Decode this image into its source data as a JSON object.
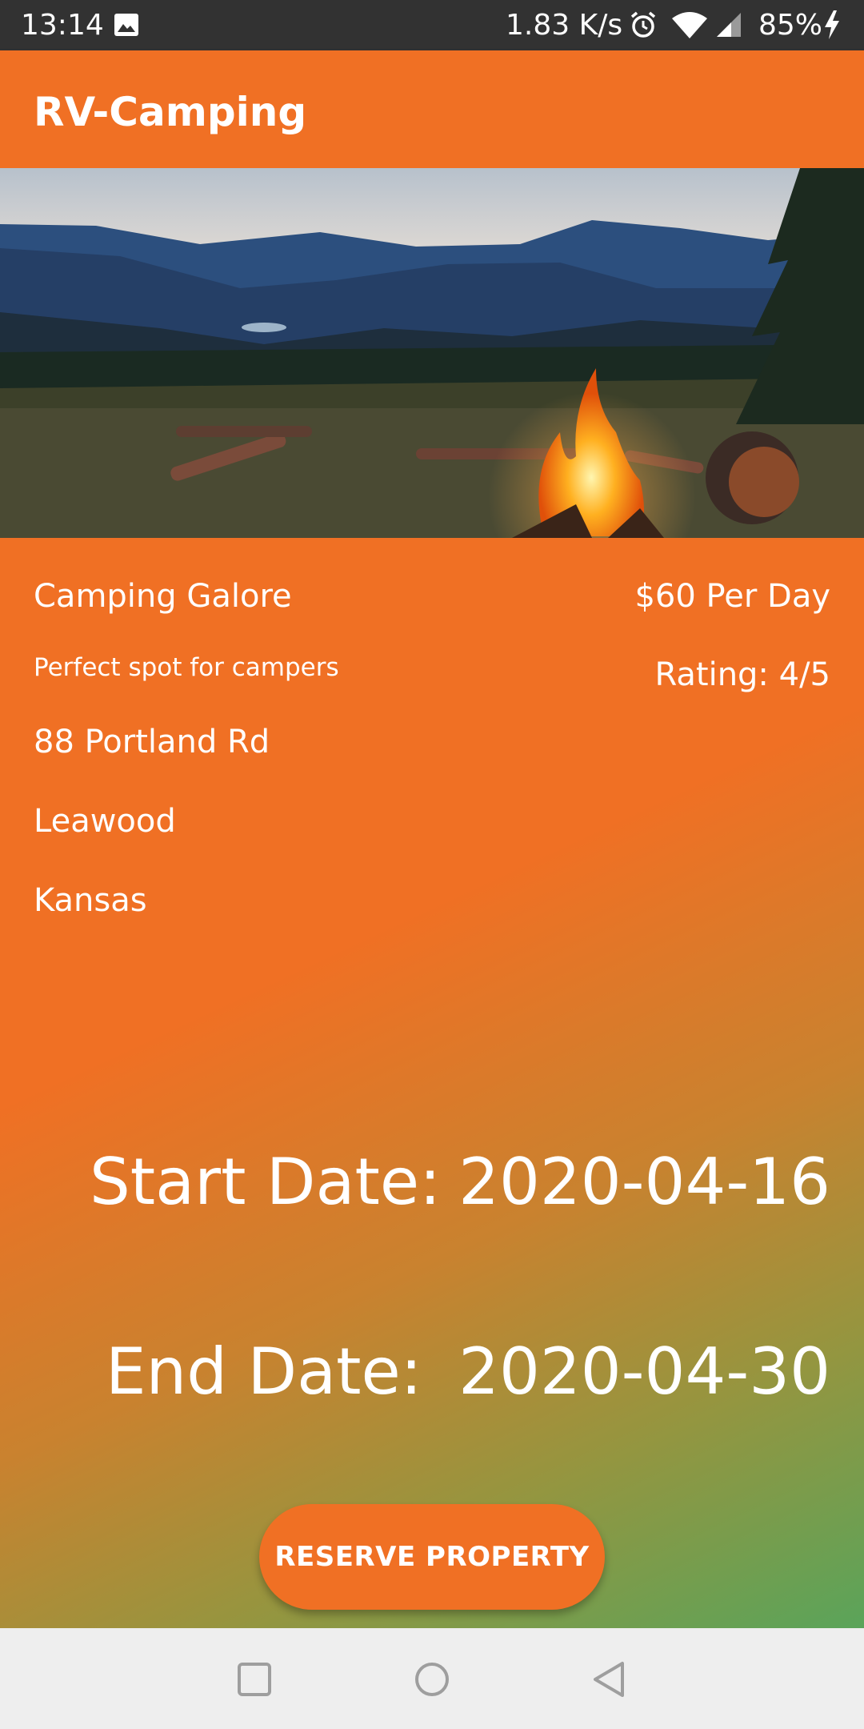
{
  "status_bar": {
    "time": "13:14",
    "network_speed": "1.83 K/s",
    "battery": "85%",
    "icons": [
      "image-icon",
      "alarm-icon",
      "wifi-icon",
      "signal-icon",
      "charging-icon"
    ]
  },
  "app_bar": {
    "title": "RV-Camping"
  },
  "hero": {
    "description_icon": "campfire-mountain-photo"
  },
  "listing": {
    "name": "Camping Galore",
    "description": "Perfect spot for campers",
    "address": "88 Portland Rd",
    "city": "Leawood",
    "state": "Kansas",
    "price": "$60 Per Day",
    "rating": "Rating: 4/5"
  },
  "dates": {
    "start_label": "Start Date:",
    "start_value": "2020-04-16",
    "end_label": "End Date:",
    "end_value": "2020-04-30"
  },
  "actions": {
    "reserve_label": "RESERVE PROPERTY"
  },
  "colors": {
    "primary": "#F07024",
    "gradient_end": "#5AA45A",
    "status_bar": "#323232",
    "nav_bar": "#EEEEEE"
  }
}
